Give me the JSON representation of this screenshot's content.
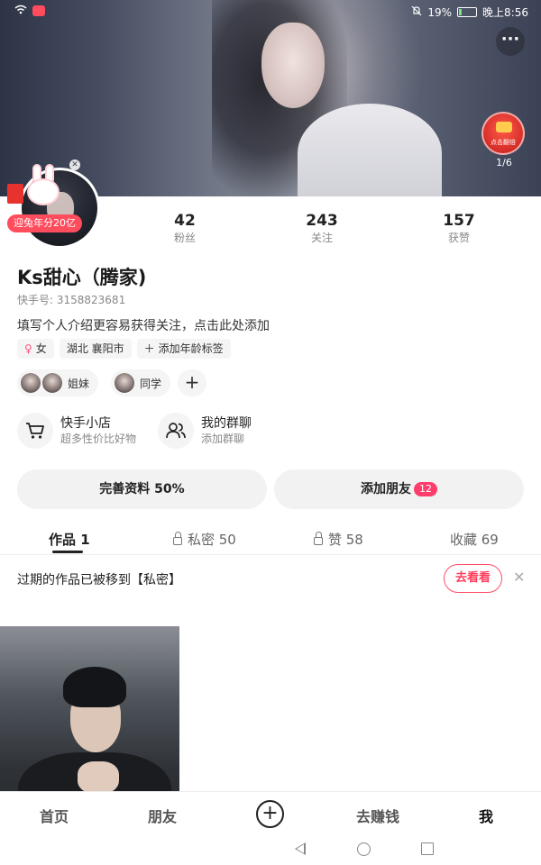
{
  "status_bar": {
    "battery": "19%",
    "time": "晚上8:56",
    "battery_level": 0.19
  },
  "banner": {
    "image_counter": "1/6",
    "red_packet_label": "点击翻倍"
  },
  "avatar": {
    "promo_tag": "迎兔年分20亿"
  },
  "stats": [
    {
      "value": "42",
      "label": "粉丝"
    },
    {
      "value": "243",
      "label": "关注"
    },
    {
      "value": "157",
      "label": "获赞"
    }
  ],
  "profile": {
    "nickname": "Ks甜心（腾家)",
    "uid": "快手号: 3158823681",
    "bio": "填写个人介绍更容易获得关注，点击此处添加"
  },
  "tags": {
    "gender": "女",
    "location": "湖北 襄阳市",
    "add_age": "添加年龄标签"
  },
  "relations": {
    "sisters": "姐妹",
    "classmates": "同学"
  },
  "features": {
    "shop_title": "快手小店",
    "shop_sub": "超多性价比好物",
    "group_title": "我的群聊",
    "group_sub": "添加群聊"
  },
  "actions": {
    "complete_profile": "完善资料 50%",
    "add_friends": "添加朋友",
    "add_friends_badge": "12"
  },
  "tabs": [
    {
      "label": "作品 1"
    },
    {
      "label": "私密 50"
    },
    {
      "label": "赞 58"
    },
    {
      "label": "收藏 69"
    }
  ],
  "notice": {
    "text": "过期的作品已被移到【私密】",
    "button": "去看看"
  },
  "bottom_nav": {
    "home": "首页",
    "friends": "朋友",
    "earn": "去赚钱",
    "me": "我"
  },
  "colors": {
    "accent": "#ff3d6b",
    "promo": "#ff4d5e"
  }
}
